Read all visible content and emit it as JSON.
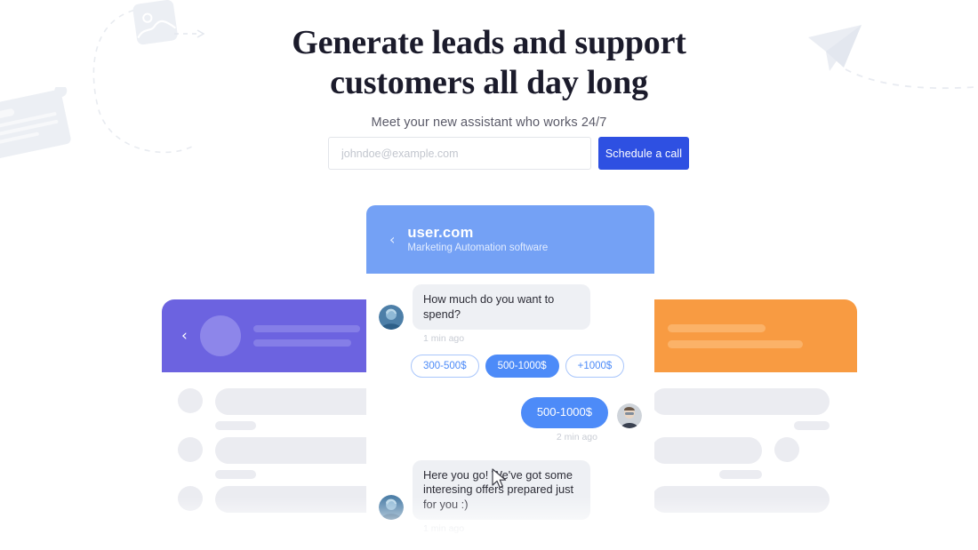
{
  "hero": {
    "title_line1": "Generate leads and support",
    "title_line2": "customers all day long",
    "subtitle": "Meet your new assistant who works 24/7"
  },
  "form": {
    "email_placeholder": "johndoe@example.com",
    "email_value": "",
    "cta_label": "Schedule a call"
  },
  "chat": {
    "back_icon": "‹",
    "brand": "user.com",
    "brand_subtitle": "Marketing Automation software",
    "messages": [
      {
        "direction": "in",
        "text": "How much do you want to spend?",
        "time": "1 min ago"
      },
      {
        "direction": "out",
        "text": "500-1000$",
        "time": "2 min ago"
      },
      {
        "direction": "in",
        "text": "Here you go! We've got some interesing offers prepared just for you :)",
        "time": "1 min ago"
      }
    ],
    "quick_replies": [
      {
        "label": "300-500$",
        "selected": false
      },
      {
        "label": "500-1000$",
        "selected": true
      },
      {
        "label": "+1000$",
        "selected": false
      }
    ]
  },
  "side_cards": {
    "left": {
      "back_icon": "‹",
      "accent": "#6c63e0"
    },
    "right": {
      "accent": "#f89b42"
    }
  },
  "colors": {
    "cta_blue": "#2e50e2",
    "chat_header_blue": "#74a1f5",
    "bubble_blue": "#4d8bf8",
    "purple": "#6c63e0",
    "orange": "#f89b42",
    "skeleton_grey": "#ebecf1"
  }
}
